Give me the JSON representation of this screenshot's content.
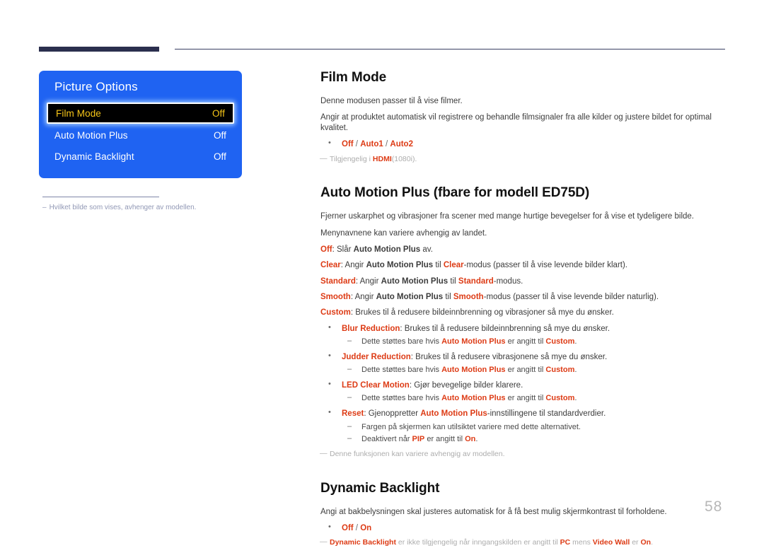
{
  "page": {
    "number": "58"
  },
  "osd": {
    "title": "Picture Options",
    "rows": [
      {
        "label": "Film Mode",
        "value": "Off",
        "selected": true
      },
      {
        "label": "Auto Motion Plus",
        "value": "Off",
        "selected": false
      },
      {
        "label": "Dynamic Backlight",
        "value": "Off",
        "selected": false
      }
    ],
    "note": "Hvilket bilde som vises, avhenger av modellen.",
    "note_dash": "–"
  },
  "sections": {
    "film_mode": {
      "heading": "Film Mode",
      "p1": "Denne modusen passer til å vise filmer.",
      "p2": "Angir at produktet automatisk vil registrere og behandle filmsignaler fra alle kilder og justere bildet for optimal kvalitet.",
      "options": {
        "opt1": "Off",
        "sep1": " / ",
        "opt2": "Auto1",
        "sep2": " / ",
        "opt3": "Auto2"
      },
      "note_pre": "Tilgjengelig i ",
      "note_term": "HDMI",
      "note_post": "(1080i)."
    },
    "auto_motion_plus": {
      "heading": "Auto Motion Plus (fbare for modell ED75D)",
      "p1": "Fjerner uskarphet og vibrasjoner fra scener med mange hurtige bevegelser for å vise et tydeligere bilde.",
      "p2": "Menynavnene kan variere avhengig av landet.",
      "modes": [
        {
          "name": "Off",
          "t1": ": Slår ",
          "term": "Auto Motion Plus",
          "t2": " av."
        },
        {
          "name": "Clear",
          "t1": ": Angir ",
          "term": "Auto Motion Plus",
          "t2": " til ",
          "term2": "Clear",
          "t3": "-modus (passer til å vise levende bilder klart)."
        },
        {
          "name": "Standard",
          "t1": ": Angir ",
          "term": "Auto Motion Plus",
          "t2": " til ",
          "term2": "Standard",
          "t3": "-modus."
        },
        {
          "name": "Smooth",
          "t1": ": Angir ",
          "term": "Auto Motion Plus",
          "t2": " til ",
          "term2": "Smooth",
          "t3": "-modus (passer til å vise levende bilder naturlig)."
        },
        {
          "name": "Custom",
          "t1": ": Brukes til å redusere bildeinnbrenning og vibrasjoner så mye du ønsker."
        }
      ],
      "bullets": [
        {
          "name": "Blur Reduction",
          "text": ": Brukes til å redusere bildeinnbrenning så mye du ønsker.",
          "sub_pre": "Dette støttes bare hvis ",
          "sub_term": "Auto Motion Plus",
          "sub_mid": " er angitt til ",
          "sub_term2": "Custom",
          "sub_post": "."
        },
        {
          "name": "Judder Reduction",
          "text": ": Brukes til å redusere vibrasjonene så mye du ønsker.",
          "sub_pre": "Dette støttes bare hvis ",
          "sub_term": "Auto Motion Plus",
          "sub_mid": " er angitt til ",
          "sub_term2": "Custom",
          "sub_post": "."
        },
        {
          "name": "LED Clear Motion",
          "text": ": Gjør bevegelige bilder klarere.",
          "sub_pre": "Dette støttes bare hvis ",
          "sub_term": "Auto Motion Plus",
          "sub_mid": " er angitt til ",
          "sub_term2": "Custom",
          "sub_post": "."
        }
      ],
      "reset": {
        "name": "Reset",
        "t1": ": Gjenoppretter ",
        "term": "Auto Motion Plus",
        "t2": "-innstillingene til standardverdier.",
        "sub1": "Fargen på skjermen kan utilsiktet variere med dette alternativet.",
        "sub2_pre": "Deaktivert når ",
        "sub2_term": "PIP",
        "sub2_mid": " er angitt til ",
        "sub2_term2": "On",
        "sub2_post": "."
      },
      "note": "Denne funksjonen kan variere avhengig av modellen."
    },
    "dynamic_backlight": {
      "heading": "Dynamic Backlight",
      "p1": "Angi at bakbelysningen skal justeres automatisk for å få best mulig skjermkontrast til forholdene.",
      "options": {
        "opt1": "Off",
        "sep1": " / ",
        "opt2": "On"
      },
      "note_term": "Dynamic Backlight",
      "note_mid": " er ikke tilgjengelig når inngangskilden er angitt til ",
      "note_term2": "PC",
      "note_mid2": " mens ",
      "note_term3": "Video Wall",
      "note_mid3": " er ",
      "note_term4": "On",
      "note_post": "."
    }
  },
  "colors": {
    "osd_blue": "#1f63f2",
    "accent_red": "#dd3b15",
    "rule_navy": "#2b2f4e",
    "selected_text": "#f5c518"
  }
}
